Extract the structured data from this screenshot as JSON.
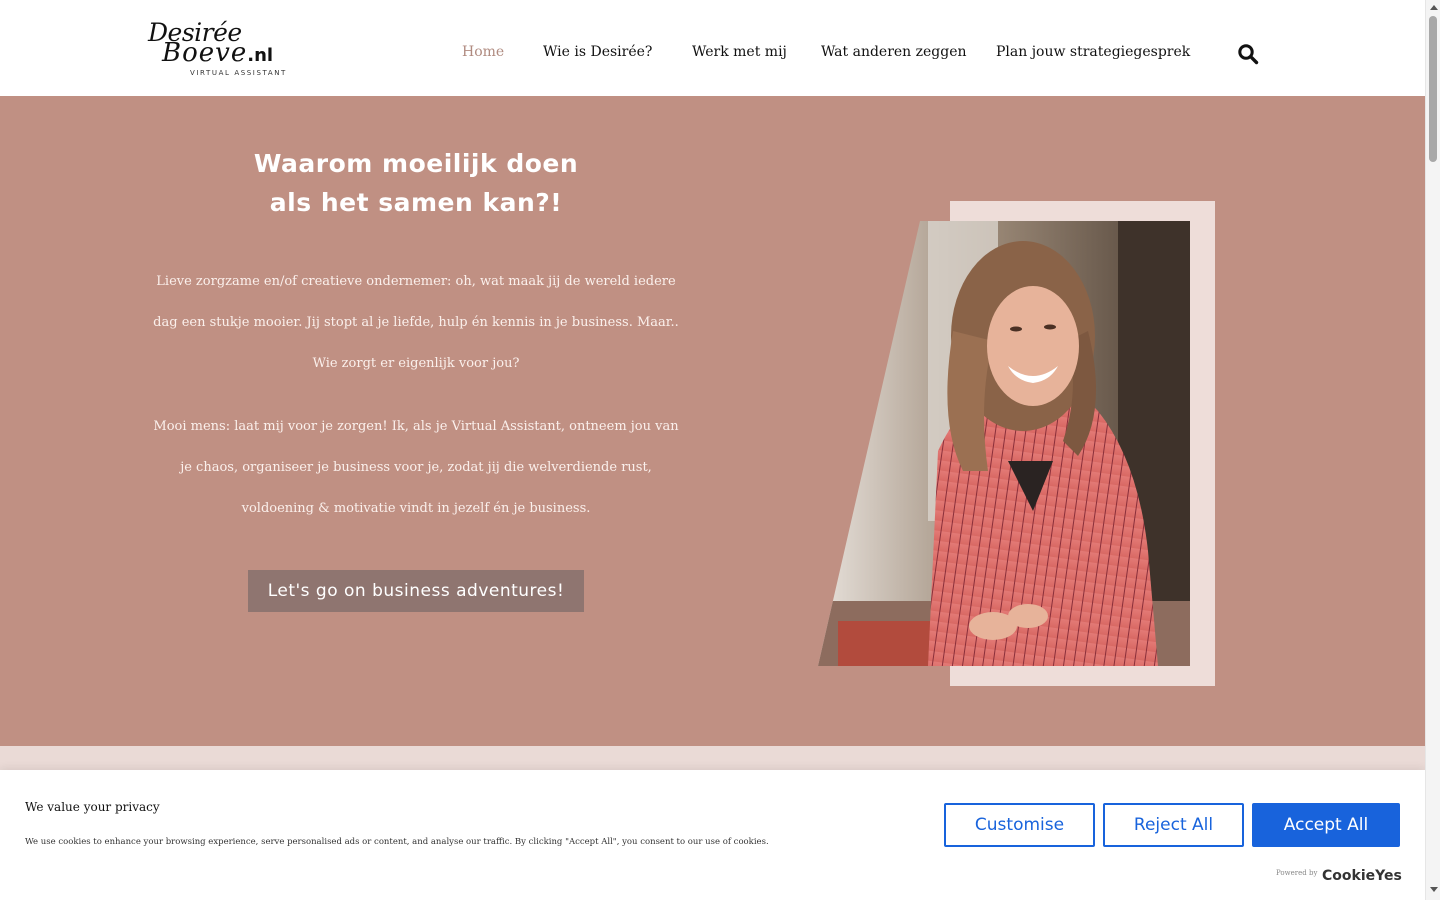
{
  "logo": {
    "line1": "Desirée",
    "line2": "Boeve",
    "tld": ".nl",
    "tagline": "VIRTUAL ASSISTANT"
  },
  "nav": {
    "items": [
      {
        "label": "Home",
        "active": true
      },
      {
        "label": "Wie is Desirée?",
        "active": false
      },
      {
        "label": "Werk met mij",
        "active": false
      },
      {
        "label": "Wat anderen zeggen",
        "active": false
      },
      {
        "label": "Plan jouw strategiegesprek",
        "active": false
      }
    ],
    "search_icon": "search-icon"
  },
  "hero": {
    "title_line1": "Waarom moeilijk doen",
    "title_line2": "als het samen kan?!",
    "paragraph1": "Lieve zorgzame en/of creatieve ondernemer: oh, wat maak jij de wereld iedere dag een stukje mooier. Jij stopt al je liefde, hulp én kennis in je business. Maar.. Wie zorgt er eigenlijk voor jou?",
    "paragraph2": "Mooi mens: laat mij voor je zorgen! Ik, als je Virtual Assistant, ontneem jou van je chaos, organiseer je business voor je, zodat jij die welverdiende rust, voldoening & motivatie vindt in jezelf én je business.",
    "cta_label": "Let's go on business adventures!",
    "background_color": "#c09083",
    "cta_color": "#8f7570"
  },
  "cookie": {
    "title": "We value your privacy",
    "text": "We use cookies to enhance your browsing experience, serve personalised ads or content, and analyse our traffic. By clicking \"Accept All\", you consent to our use of cookies.",
    "customise_label": "Customise",
    "reject_label": "Reject All",
    "accept_label": "Accept All",
    "powered_by": "Powered by",
    "brand": "CookieYes",
    "accent_color": "#1863dc"
  }
}
